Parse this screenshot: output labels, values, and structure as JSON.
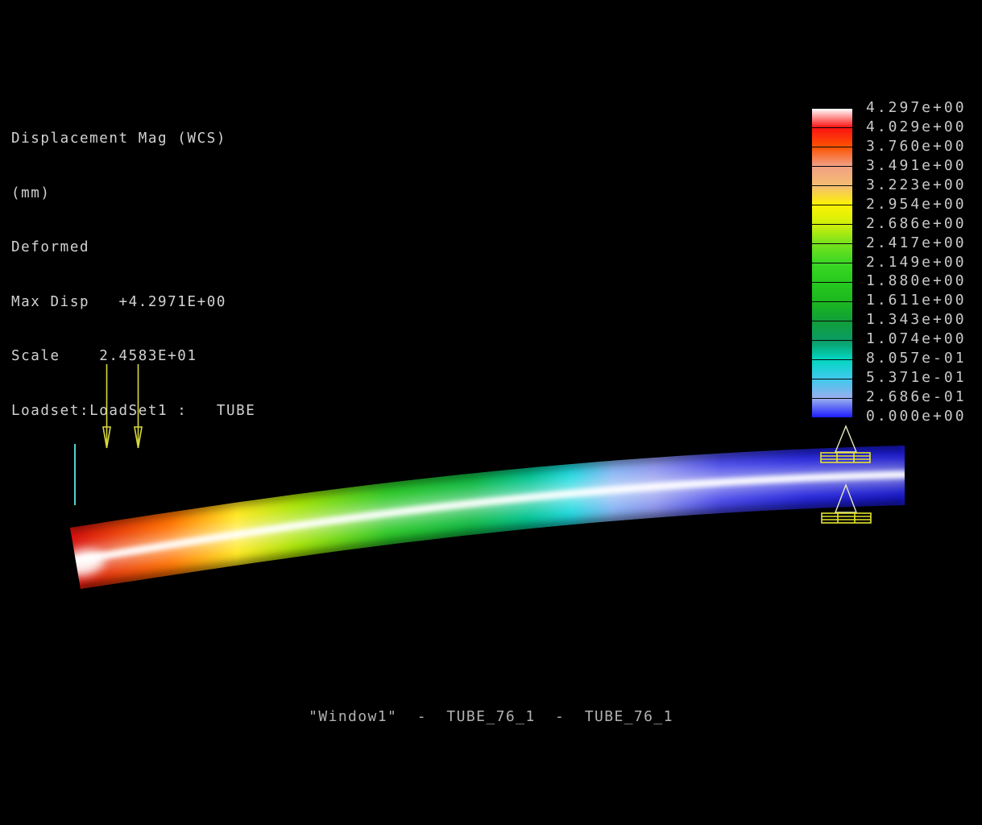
{
  "info_panel": {
    "lines": [
      "Displacement Mag (WCS)",
      "(mm)",
      "Deformed",
      "Max Disp   +4.2971E+00",
      "Scale    2.4583E+01",
      "Loadset:LoadSet1 :   TUBE"
    ]
  },
  "legend": {
    "values": [
      "4.297e+00",
      "4.029e+00",
      "3.760e+00",
      "3.491e+00",
      "3.223e+00",
      "2.954e+00",
      "2.686e+00",
      "2.417e+00",
      "2.149e+00",
      "1.880e+00",
      "1.611e+00",
      "1.343e+00",
      "1.074e+00",
      "8.057e-01",
      "5.371e-01",
      "2.686e-01",
      "0.000e+00"
    ],
    "band_colors": [
      "#ffffff",
      "#fc1412",
      "#fd5302",
      "#f0a184",
      "#f6bd72",
      "#fcf303",
      "#cfef0a",
      "#77e31c",
      "#3bd724",
      "#27ca1e",
      "#1cb81f",
      "#119f39",
      "#0b9c63",
      "#02d6c2",
      "#3fc9ec",
      "#98aeee",
      "#1d1dfc"
    ]
  },
  "tube": {
    "gradient": [
      {
        "offset": 0.0,
        "color": "#d80f0f"
      },
      {
        "offset": 0.12,
        "color": "#ff7300"
      },
      {
        "offset": 0.2,
        "color": "#ffe81e"
      },
      {
        "offset": 0.27,
        "color": "#a8e403"
      },
      {
        "offset": 0.38,
        "color": "#2cc826"
      },
      {
        "offset": 0.48,
        "color": "#12bb45"
      },
      {
        "offset": 0.55,
        "color": "#04c694"
      },
      {
        "offset": 0.6,
        "color": "#20d8e0"
      },
      {
        "offset": 0.65,
        "color": "#86b4f4"
      },
      {
        "offset": 0.7,
        "color": "#8e96ee"
      },
      {
        "offset": 0.78,
        "color": "#4646e8"
      },
      {
        "offset": 0.88,
        "color": "#2424dc"
      },
      {
        "offset": 1.0,
        "color": "#1616c8"
      }
    ]
  },
  "footer": {
    "title": "\"Window1\"  -  TUBE_76_1  -  TUBE_76_1"
  },
  "colors": {
    "background": "#000000",
    "text": "#d2d2d2",
    "legend_text": "#c9c9c9",
    "title_text": "#b2b2b2",
    "arrow": "#d9d93f",
    "support": "#e3e32e",
    "support_triangle": "#e9e9c0",
    "edge_line": "#54cfcf"
  }
}
